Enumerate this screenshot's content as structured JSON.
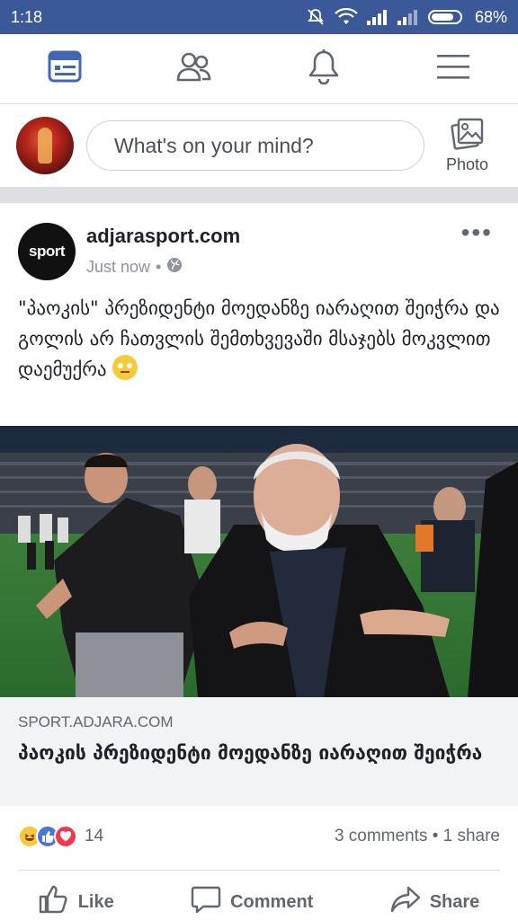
{
  "status_bar": {
    "time": "1:18",
    "battery": "68%"
  },
  "nav": {
    "items": [
      {
        "name": "news-feed",
        "icon": "news-feed-icon"
      },
      {
        "name": "friends",
        "icon": "friends-icon"
      },
      {
        "name": "notifications",
        "icon": "bell-icon"
      },
      {
        "name": "menu",
        "icon": "hamburger-icon"
      }
    ]
  },
  "composer": {
    "placeholder": "What's on your mind?",
    "photo_label": "Photo"
  },
  "post": {
    "page_name": "adjarasport.com",
    "logo_text": "sport",
    "timestamp": "Just now",
    "privacy_icon": "globe-icon",
    "text": "\"პაოკის\" პრეზიდენტი მოედანზე იარაღით შეიჭრა და გოლის არ ჩათვლის შემთხვევაში მსაჯებს მოკვლით დაემუქრა",
    "emoji": "eye-roll-emoji",
    "link": {
      "domain": "SPORT.ADJARA.COM",
      "title": "პაოკის პრეზიდენტი მოედანზე იარაღით შეიჭრა"
    },
    "reactions": {
      "types": [
        "haha",
        "like",
        "love"
      ],
      "count": "14"
    },
    "engagement": "3 comments • 1 share",
    "actions": {
      "like": "Like",
      "comment": "Comment",
      "share": "Share"
    }
  },
  "colors": {
    "brand": "#3b5998",
    "text": "#1d2129",
    "muted": "#606770",
    "card_bg": "#f2f3f5"
  }
}
